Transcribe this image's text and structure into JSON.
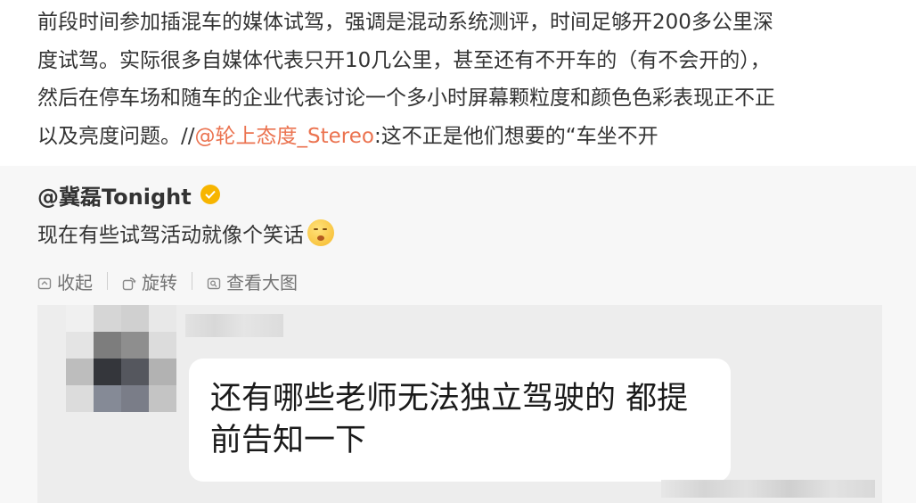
{
  "post": {
    "line1": "前段时间参加插混车的媒体试驾，强调是混动系统测评，时间足够开200多公里深",
    "line2": "度试驾。实际很多自媒体代表只开10几公里，甚至还有不开车的（有不会开的），",
    "line3": "然后在停车场和随车的企业代表讨论一个多小时屏幕颗粒度和颜色色彩表现正不正",
    "line4_prefix": "以及亮度问题。//",
    "line4_mention": "@轮上态度_Stereo",
    "line4_suffix": ":这不正是他们想要的“车坐不开"
  },
  "retweet": {
    "author": "@冀磊Tonight",
    "badge_icon": "verified-badge-icon",
    "text": "现在有些试驾活动就像个笑话",
    "emoji": "shushing-face-emoji",
    "actions": {
      "collapse": "收起",
      "rotate": "旋转",
      "view_large": "查看大图"
    },
    "image": {
      "chat_text": "还有哪些老师无法独立驾驶的 都提前告知一下"
    }
  },
  "colors": {
    "mention": "#eb7350",
    "badge": "#f7b500",
    "retweet_bg": "#f7f7f7",
    "action_text": "#737373"
  }
}
